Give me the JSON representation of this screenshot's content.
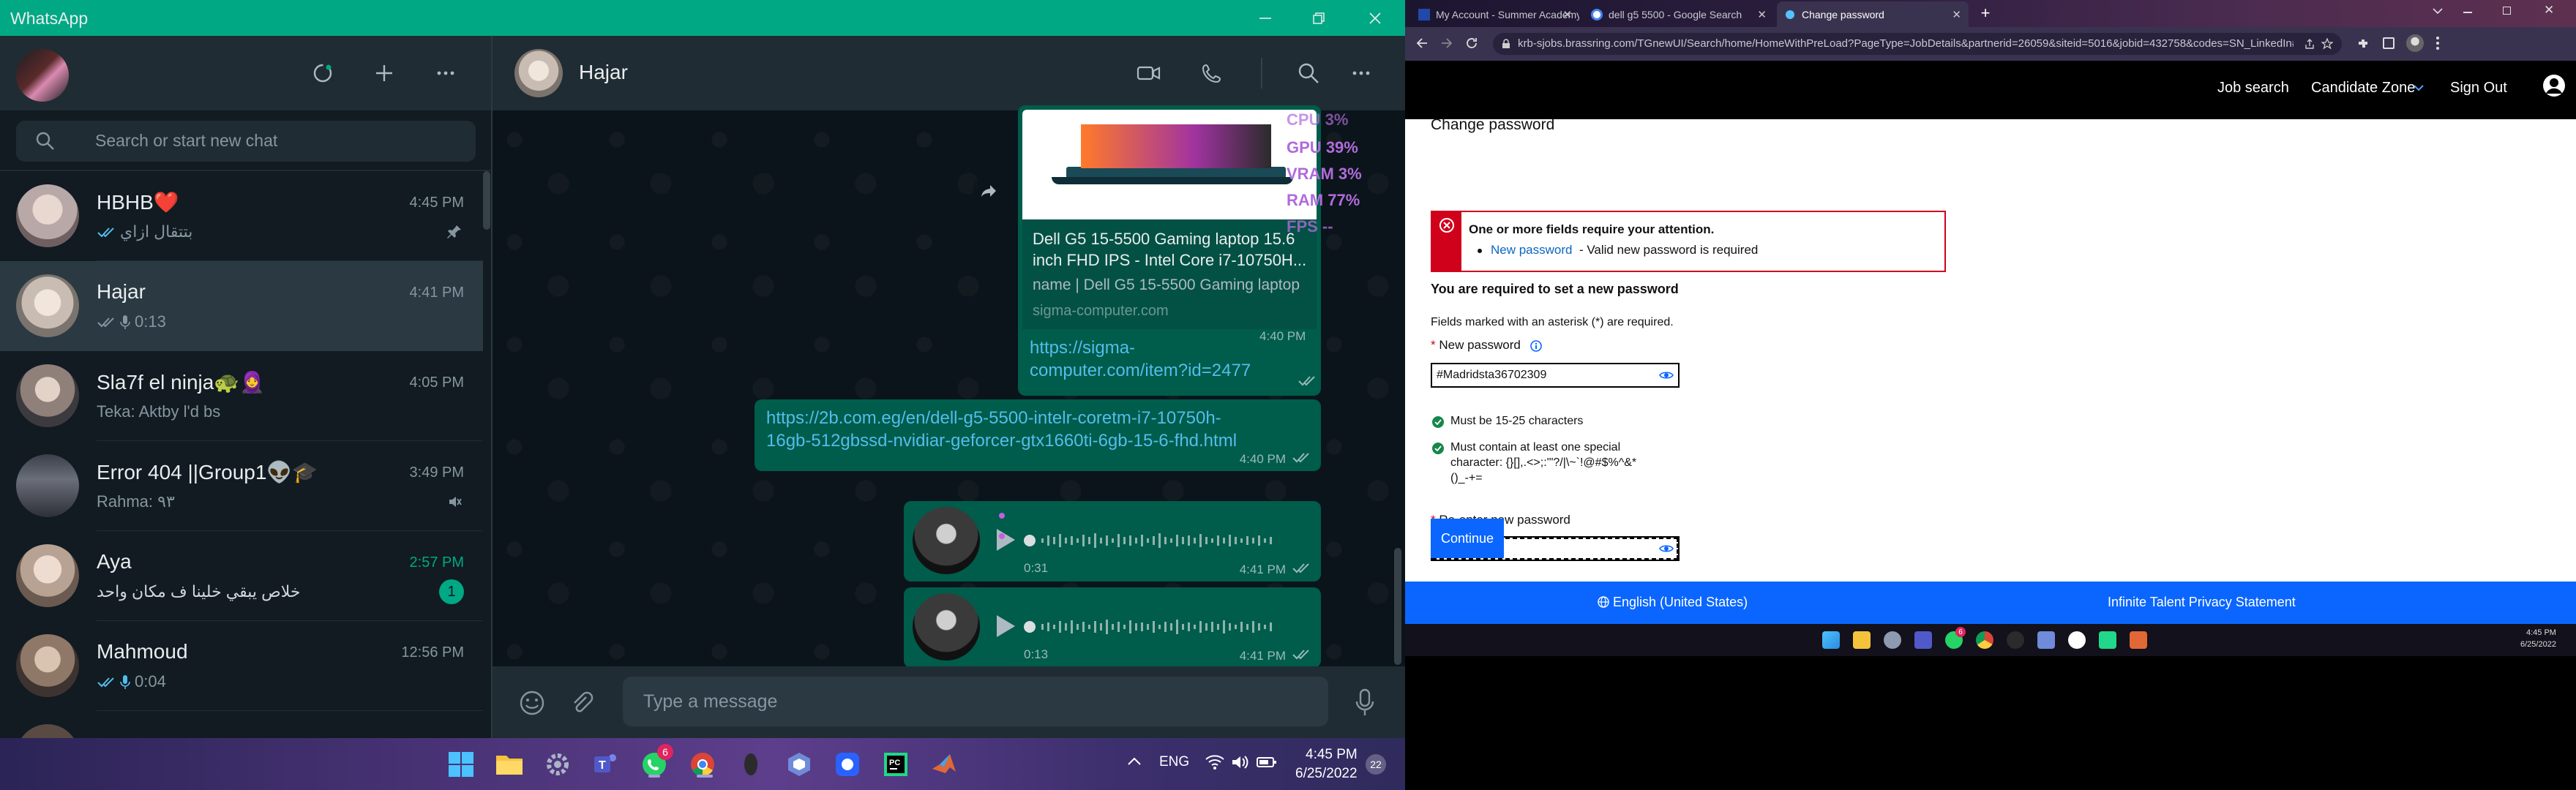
{
  "whatsapp": {
    "window_title": "WhatsApp",
    "search_placeholder": "Search or start new chat",
    "chats": [
      {
        "name": "HBHB❤️",
        "time": "4:45 PM",
        "preview": "بتتقال ازاي",
        "pinned": true
      },
      {
        "name": "Hajar",
        "time": "4:41 PM",
        "preview": "0:13",
        "selected": true
      },
      {
        "name": "Sla7f el ninja🐢🧕",
        "time": "4:05 PM",
        "preview": "Teka: Aktby l'd bs"
      },
      {
        "name": "Error 404 ||Group1👽🎓",
        "time": "3:49 PM",
        "preview": "Rahma: ٩٣",
        "muted": true
      },
      {
        "name": "Aya",
        "time": "2:57 PM",
        "preview": "خلاص يبقي خلينا ف مكان واحد",
        "unread": "1"
      },
      {
        "name": "Mahmoud",
        "time": "12:56 PM",
        "preview": "0:04"
      }
    ],
    "conversation": {
      "contact_name": "Hajar",
      "perf_overlay": [
        {
          "label": "CPU",
          "value": "3%"
        },
        {
          "label": "GPU",
          "value": "39%"
        },
        {
          "label": "VRAM",
          "value": "3%"
        },
        {
          "label": "RAM",
          "value": "77%"
        },
        {
          "label": "FPS",
          "value": "--"
        }
      ],
      "link_card": {
        "title": "Dell G5 15-5500 Gaming laptop 15.6 inch FHD IPS - Intel Core i7-10750H...",
        "description": "name | Dell G5 15-5500 Gaming laptop",
        "domain": "sigma-computer.com",
        "time": "4:40 PM",
        "url": "https://sigma-computer.com/item?id=2477"
      },
      "link_message": {
        "url": "https://2b.com.eg/en/dell-g5-5500-intelr-coretm-i7-10750h-16gb-512gbssd-nvidiar-geforcer-gtx1660ti-6gb-15-6-fhd.html",
        "time": "4:40 PM"
      },
      "voice_messages": [
        {
          "duration": "0:31",
          "time": "4:41 PM"
        },
        {
          "duration": "0:13",
          "time": "4:41 PM"
        }
      ],
      "input_placeholder": "Type a message"
    },
    "taskbar": {
      "lang": "ENG",
      "time": "4:45 PM",
      "date": "6/25/2022",
      "whatsapp_badge": "6",
      "notification_count": "22"
    }
  },
  "chrome": {
    "tabs": [
      {
        "title": "My Account - Summer Academy",
        "active": false
      },
      {
        "title": "dell g5 5500 - Google Search",
        "active": false
      },
      {
        "title": "Change password",
        "active": true
      }
    ],
    "url": "krb-sjobs.brassring.com/TGnewUI/Search/home/HomeWithPreLoad?PageType=JobDetails&partnerid=26059&siteid=5016&jobid=432758&codes=SN_LinkedIn#jobDetail...",
    "site_nav": {
      "job_search": "Job search",
      "candidate_zone": "Candidate Zone",
      "sign_out": "Sign Out"
    },
    "page": {
      "heading": "Change password",
      "error_title": "One or more fields require your attention.",
      "error_item_link": "New password",
      "error_item_text": "- Valid new password is required",
      "instruction": "You are required to set a new password",
      "required_note": "Fields marked with an asterisk (*) are required.",
      "new_password_label": "New password",
      "new_password_value": "#Madridsta36702309",
      "rule_1": "Must be 15-25 characters",
      "rule_2_line1": "Must contain at least one special",
      "rule_2_line2": "character: {}[],.<>;:'\"?/|\\~`!@#$%^&*",
      "rule_2_line3": "()_-+=",
      "reenter_label": "Re-enter new password",
      "reenter_value": "••••••••••••••••••",
      "continue_label": "Continue"
    },
    "footer": {
      "language": "English (United States)",
      "privacy": "Infinite Talent Privacy Statement"
    },
    "taskbar": {
      "time": "4:45 PM",
      "date": "6/25/2022",
      "whatsapp_badge": "6"
    }
  },
  "colors": {
    "whatsapp_green": "#00a884",
    "bubble_out": "#005c4b",
    "error_red": "#d0021b",
    "brand_blue": "#0a66ff"
  }
}
